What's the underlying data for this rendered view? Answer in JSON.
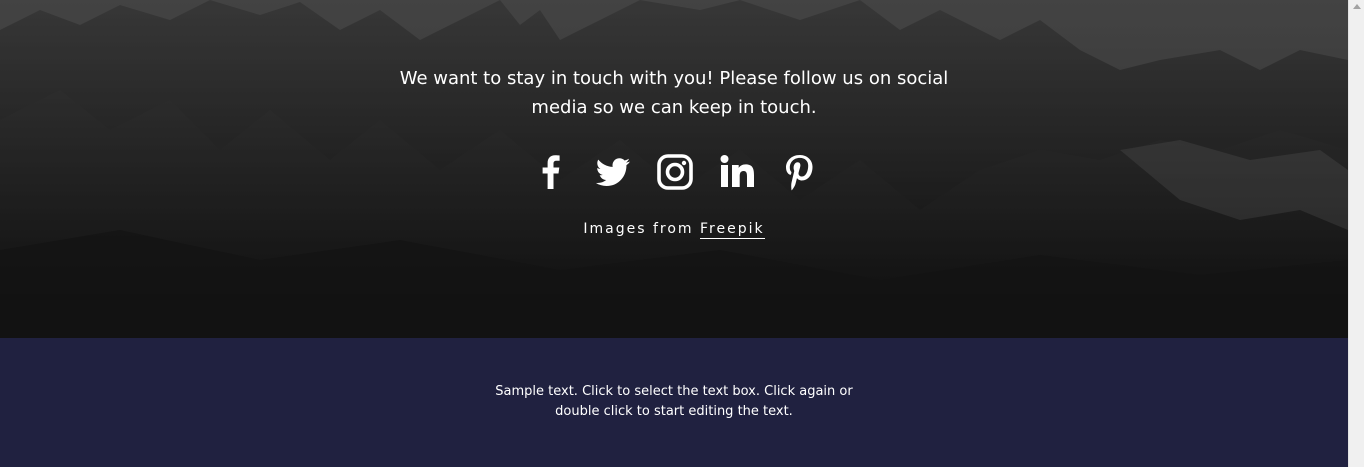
{
  "hero": {
    "intro_text": "We want to stay in touch with you! Please follow us on social media so we can keep in touch.",
    "social_icons": [
      "facebook-icon",
      "twitter-icon",
      "instagram-icon",
      "linkedin-icon",
      "pinterest-icon"
    ],
    "credit_prefix": "Images from",
    "credit_link": "Freepik"
  },
  "footer": {
    "text": "Sample text. Click to select the text box. Click again or double click to start editing the text.",
    "background_color": "#202140"
  }
}
